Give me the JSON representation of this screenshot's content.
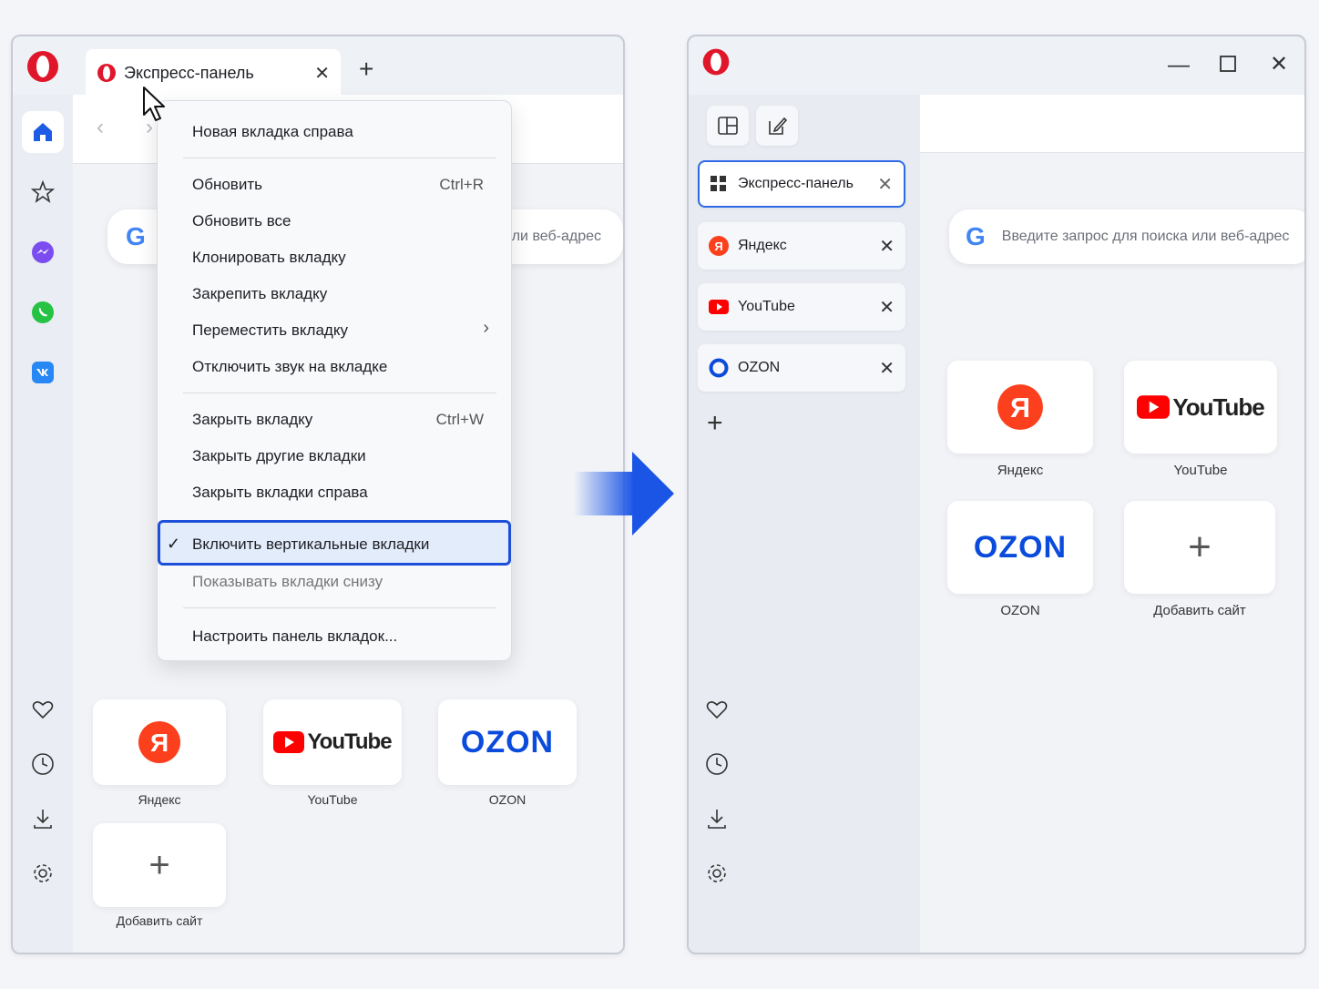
{
  "left": {
    "tab_title": "Экспресс-панель",
    "search_placeholder_tail": "ли веб-адрес",
    "menu": {
      "new_tab_right": "Новая вкладка справа",
      "reload": "Обновить",
      "reload_shortcut": "Ctrl+R",
      "reload_all": "Обновить все",
      "clone_tab": "Клонировать вкладку",
      "pin_tab": "Закрепить вкладку",
      "move_tab": "Переместить вкладку",
      "mute_tab": "Отключить звук на вкладке",
      "close_tab": "Закрыть вкладку",
      "close_tab_shortcut": "Ctrl+W",
      "close_other": "Закрыть другие вкладки",
      "close_right": "Закрыть вкладки справа",
      "vertical_tabs": "Включить вертикальные вкладки",
      "bottom_tabs": "Показывать вкладки снизу",
      "customize": "Настроить панель вкладок..."
    },
    "tiles": [
      {
        "label": "Яндекс"
      },
      {
        "label": "YouTube"
      },
      {
        "label": "OZON"
      },
      {
        "label": "Добавить сайт"
      }
    ]
  },
  "right": {
    "tabs": [
      {
        "label": "Экспресс-панель",
        "active": true
      },
      {
        "label": "Яндекс"
      },
      {
        "label": "YouTube"
      },
      {
        "label": "OZON"
      }
    ],
    "search_placeholder": "Введите запрос для поиска или веб-адрес",
    "tiles": [
      {
        "label": "Яндекс"
      },
      {
        "label": "YouTube"
      },
      {
        "label": "OZON"
      },
      {
        "label": "Добавить сайт"
      }
    ]
  },
  "logos": {
    "youtube_word": "YouTube",
    "ozon_word": "OZON",
    "yandex_letter": "Я",
    "google_letter": "G"
  },
  "colors": {
    "accent": "#1e4fd8",
    "opera_red": "#e0162b",
    "youtube_red": "#ff0000",
    "yandex_red": "#fc3f1d",
    "ozon_blue": "#0b4bdc"
  }
}
